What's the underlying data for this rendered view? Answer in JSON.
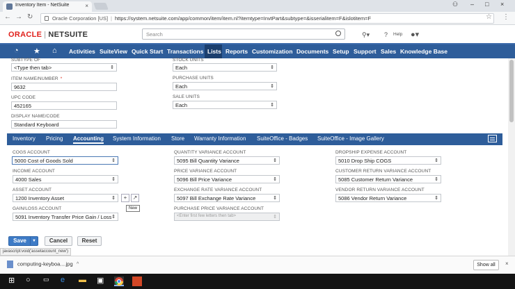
{
  "browser": {
    "tab_title": "Inventory Item - NetSuite",
    "tab_close": "×",
    "address": {
      "secure_label": "Oracle Corporation [US]",
      "url": "https://system.netsuite.com/app/common/item/item.nl?itemtype=InvtPart&subtype=&isserialitem=F&islotitem=F"
    },
    "window_controls": [
      "–",
      "□",
      "×"
    ]
  },
  "header": {
    "logo_oracle": "ORACLE",
    "logo_sep": "|",
    "logo_netsuite": "NETSUITE",
    "search_placeholder": "Search",
    "help_label": "Help"
  },
  "nav": {
    "items": [
      "Activities",
      "SuiteView",
      "Quick Start",
      "Transactions",
      "Lists",
      "Reports",
      "Customization",
      "Documents",
      "Setup",
      "Support",
      "Sales",
      "Knowledge Base"
    ],
    "active": "Lists"
  },
  "main_fields": {
    "subtype_label": "SUBTYPE OF",
    "subtype_value": "<Type then tab>",
    "item_name_label": "ITEM NAME/NUMBER",
    "item_name_required": "*",
    "item_name_value": "9632",
    "upc_label": "UPC CODE",
    "upc_value": "452165",
    "display_name_label": "DISPLAY NAME/CODE",
    "display_name_value": "Standard Keyboard",
    "stock_units_label": "STOCK UNITS",
    "stock_units_value": "Each",
    "purchase_units_label": "PURCHASE UNITS",
    "purchase_units_value": "Each",
    "sale_units_label": "SALE UNITS",
    "sale_units_value": "Each"
  },
  "subtabs": {
    "items": [
      "Inventory",
      "Pricing",
      "Accounting",
      "System Information",
      "Store",
      "Warranty Information",
      "SuiteOffice - Badges",
      "SuiteOffice - Image Gallery"
    ],
    "active": "Accounting"
  },
  "accounting": {
    "col1": [
      {
        "label": "COGS ACCOUNT",
        "value": "5000 Cost of Goods Sold"
      },
      {
        "label": "INCOME ACCOUNT",
        "value": "4000 Sales"
      },
      {
        "label": "ASSET ACCOUNT",
        "value": "1200 Inventory Asset"
      },
      {
        "label": "GAIN/LOSS ACCOUNT",
        "value": "5091 Inventory Transfer Price Gain / Loss"
      }
    ],
    "col2": [
      {
        "label": "QUANTITY VARIANCE ACCOUNT",
        "value": "5095 Bill Quantity Variance"
      },
      {
        "label": "PRICE VARIANCE ACCOUNT",
        "value": "5096 Bill Price Variance"
      },
      {
        "label": "EXCHANGE RATE VARIANCE ACCOUNT",
        "value": "5097 Bill Exchange Rate Variance"
      },
      {
        "label": "PURCHASE PRICE VARIANCE ACCOUNT",
        "value": "<Enter first few letters then tab>"
      }
    ],
    "col3": [
      {
        "label": "DROPSHIP EXPENSE ACCOUNT",
        "value": "5010 Drop Ship COGS"
      },
      {
        "label": "CUSTOMER RETURN VARIANCE ACCOUNT",
        "value": "5085 Customer Return Variance"
      },
      {
        "label": "VENDOR RETURN VARIANCE ACCOUNT",
        "value": "5086 Vendor Return Variance"
      }
    ],
    "new_button": "+",
    "tooltip": "New"
  },
  "buttons": {
    "save": "Save",
    "cancel": "Cancel",
    "reset": "Reset"
  },
  "status_url": "javascript:void('assetaccount_new')",
  "downloads": {
    "file": "computing-keyboa....jpg",
    "show_all": "Show all",
    "close": "×"
  },
  "colors": {
    "nav_blue": "#2e5d9a",
    "oracle_red": "#e0201b",
    "save_blue": "#3e7bc6"
  }
}
